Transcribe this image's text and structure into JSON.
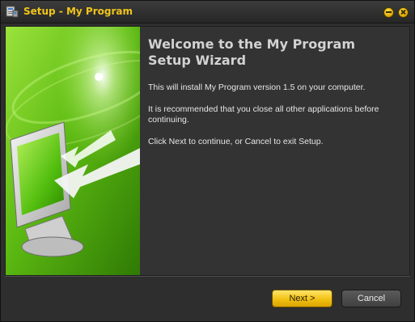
{
  "window": {
    "title": "Setup - My Program"
  },
  "welcome": {
    "heading_line1": "Welcome to the My Program",
    "heading_line2": "Setup Wizard",
    "paragraph1": "This will install My Program version 1.5 on your computer.",
    "paragraph2_line1": "It is recommended that you close all other applications before",
    "paragraph2_line2": "continuing.",
    "paragraph3": "Click Next to continue, or Cancel to exit Setup."
  },
  "buttons": {
    "next_label": "Next >",
    "cancel_label": "Cancel"
  },
  "colors": {
    "accent": "#f0c419",
    "banner_green": "#6ecb1c",
    "background": "#333333"
  },
  "icons": [
    "setup-app-icon",
    "minimize-icon",
    "close-icon",
    "monitor-illustration"
  ]
}
